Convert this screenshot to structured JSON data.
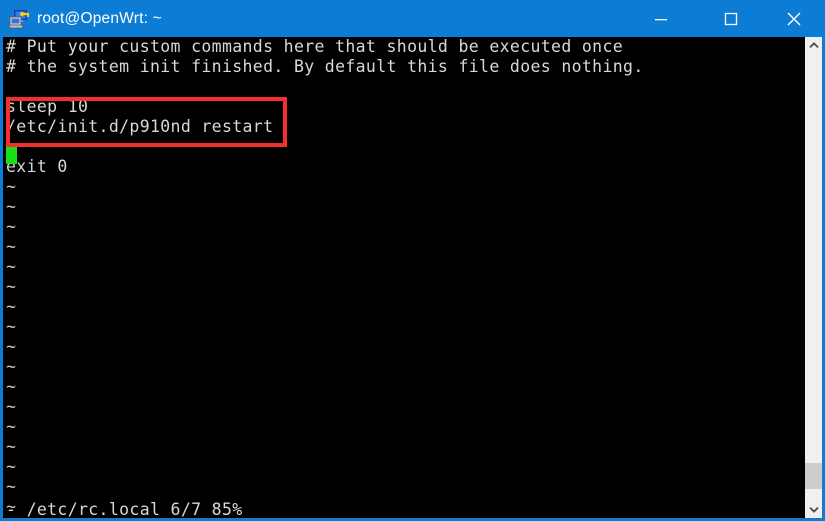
{
  "window": {
    "title": "root@OpenWrt: ~",
    "app_icon": "putty-terminal-icon",
    "titlebar_color": "#0c7cd5",
    "controls": {
      "minimize": "minimize-icon",
      "maximize": "maximize-icon",
      "close": "close-icon"
    }
  },
  "terminal": {
    "background": "#000000",
    "foreground": "#d8d8d8",
    "cursor_color": "#17e017",
    "lines": [
      "# Put your custom commands here that should be executed once",
      "# the system init finished. By default this file does nothing.",
      "",
      "sleep 10",
      "/etc/init.d/p910nd restart",
      "",
      "exit 0"
    ],
    "filler_char": "~",
    "filler_count": 17,
    "status_line": "- /etc/rc.local 6/7 85%",
    "editor_file": "/etc/rc.local",
    "editor_position": "6/7",
    "editor_percent": "85%"
  },
  "annotation": {
    "type": "rectangle-highlight",
    "color": "#f2302e",
    "highlighted_text": "sleep 10 / /etc/init.d/p910nd restart"
  },
  "scrollbar": {
    "up_arrow": "chevron-up-icon",
    "down_arrow": "chevron-down-icon",
    "track_color": "#f0f0f0",
    "thumb_color": "#cdcdcd"
  }
}
